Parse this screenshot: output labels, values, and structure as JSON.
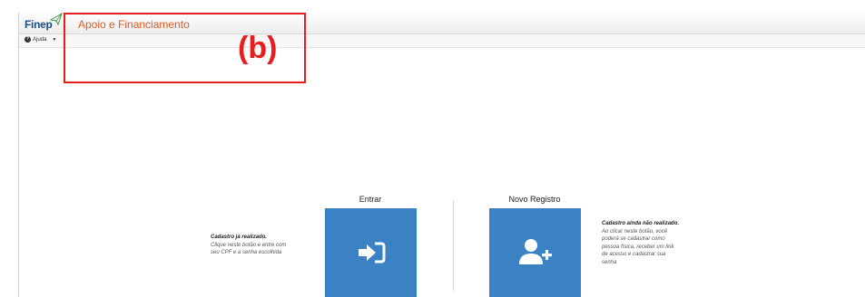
{
  "app": {
    "logo_text": "Finep",
    "page_title": "Apoio e Financiamento"
  },
  "help_menu": {
    "label": "Ajuda",
    "icon": "question-circle-icon",
    "caret_icon": "caret-down-icon"
  },
  "annotation": {
    "label": "(b)",
    "color": "#e61e1e"
  },
  "login": {
    "title": "Entrar",
    "icon": "sign-in-icon",
    "description_title": "Cadastro já realizado.",
    "description_lines": [
      "Clique neste botão e entre com",
      "seu CPF e a senha escolhida"
    ]
  },
  "register": {
    "title": "Novo Registro",
    "icon": "user-plus-icon",
    "description_title": "Cadastro ainda não realizado.",
    "description_lines": [
      "Ao clicar neste botão, você",
      "poderá se cadastrar como",
      "pessoa física, receber um link",
      "de acesso e cadastrar sua",
      "senha"
    ]
  },
  "colors": {
    "accent_title": "#e05a24",
    "tile_blue": "#3b82c4",
    "logo_blue": "#1d4f8c"
  }
}
